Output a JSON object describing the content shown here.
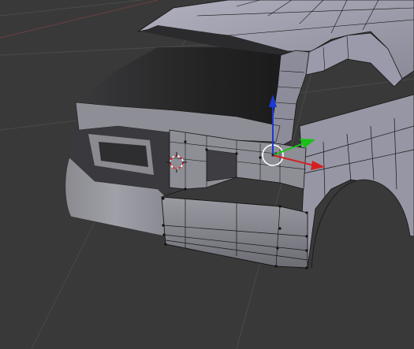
{
  "viewport": {
    "background": "#393939",
    "grid_color": "#4a4a4a",
    "mesh_light": "#9a9aa6",
    "mesh_mid": "#7e7e88",
    "mesh_dark": "#2a2a2c",
    "edge_color": "#101010"
  },
  "gizmo": {
    "x_axis_color": "#d42020",
    "y_axis_color": "#18c018",
    "z_axis_color": "#1a3ad8",
    "pivot_circle_color": "#ffffff"
  },
  "cursor_3d": {
    "ring_color": "#e02020",
    "icon": "3d-cursor-icon"
  }
}
